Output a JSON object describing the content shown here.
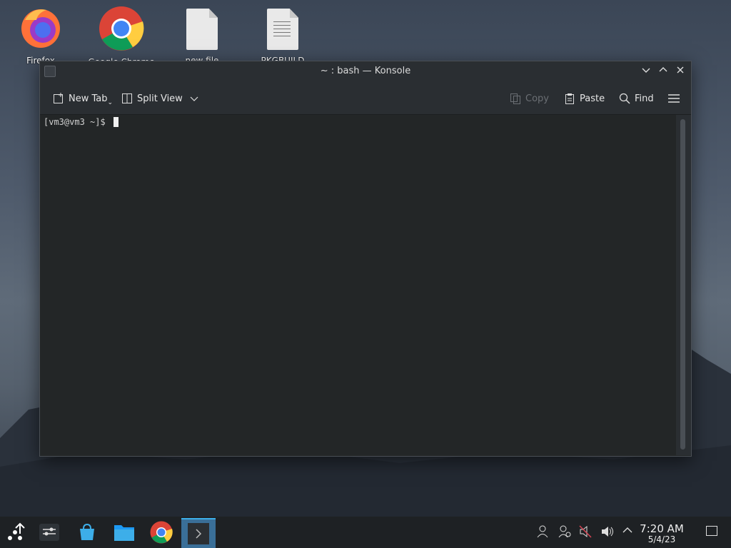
{
  "desktop": {
    "icons": [
      {
        "label": "Firefox",
        "icon": "firefox-icon"
      },
      {
        "label": "Google Chrome",
        "icon": "chrome-icon"
      },
      {
        "label": "new file",
        "icon": "file-icon"
      },
      {
        "label": "PKGBUILD",
        "icon": "document-icon"
      }
    ]
  },
  "window": {
    "title": "~ : bash — Konsole",
    "toolbar": {
      "new_tab": "New Tab",
      "split_view": "Split View",
      "copy": "Copy",
      "paste": "Paste",
      "find": "Find"
    },
    "terminal": {
      "prompt": "[vm3@vm3 ~]$ "
    }
  },
  "taskbar": {
    "apps": [
      "application-launcher-icon",
      "settings-icon",
      "discover-store-icon",
      "file-manager-icon",
      "chrome-icon",
      "konsole-icon"
    ],
    "tray": [
      "user-icon",
      "network-icon",
      "muted-audio-icon",
      "volume-icon",
      "expand-tray-icon"
    ],
    "clock": {
      "time": "7:20 AM",
      "date": "5/4/23"
    }
  },
  "colors": {
    "accent": "#3daee9",
    "terminal_bg": "#232627"
  }
}
